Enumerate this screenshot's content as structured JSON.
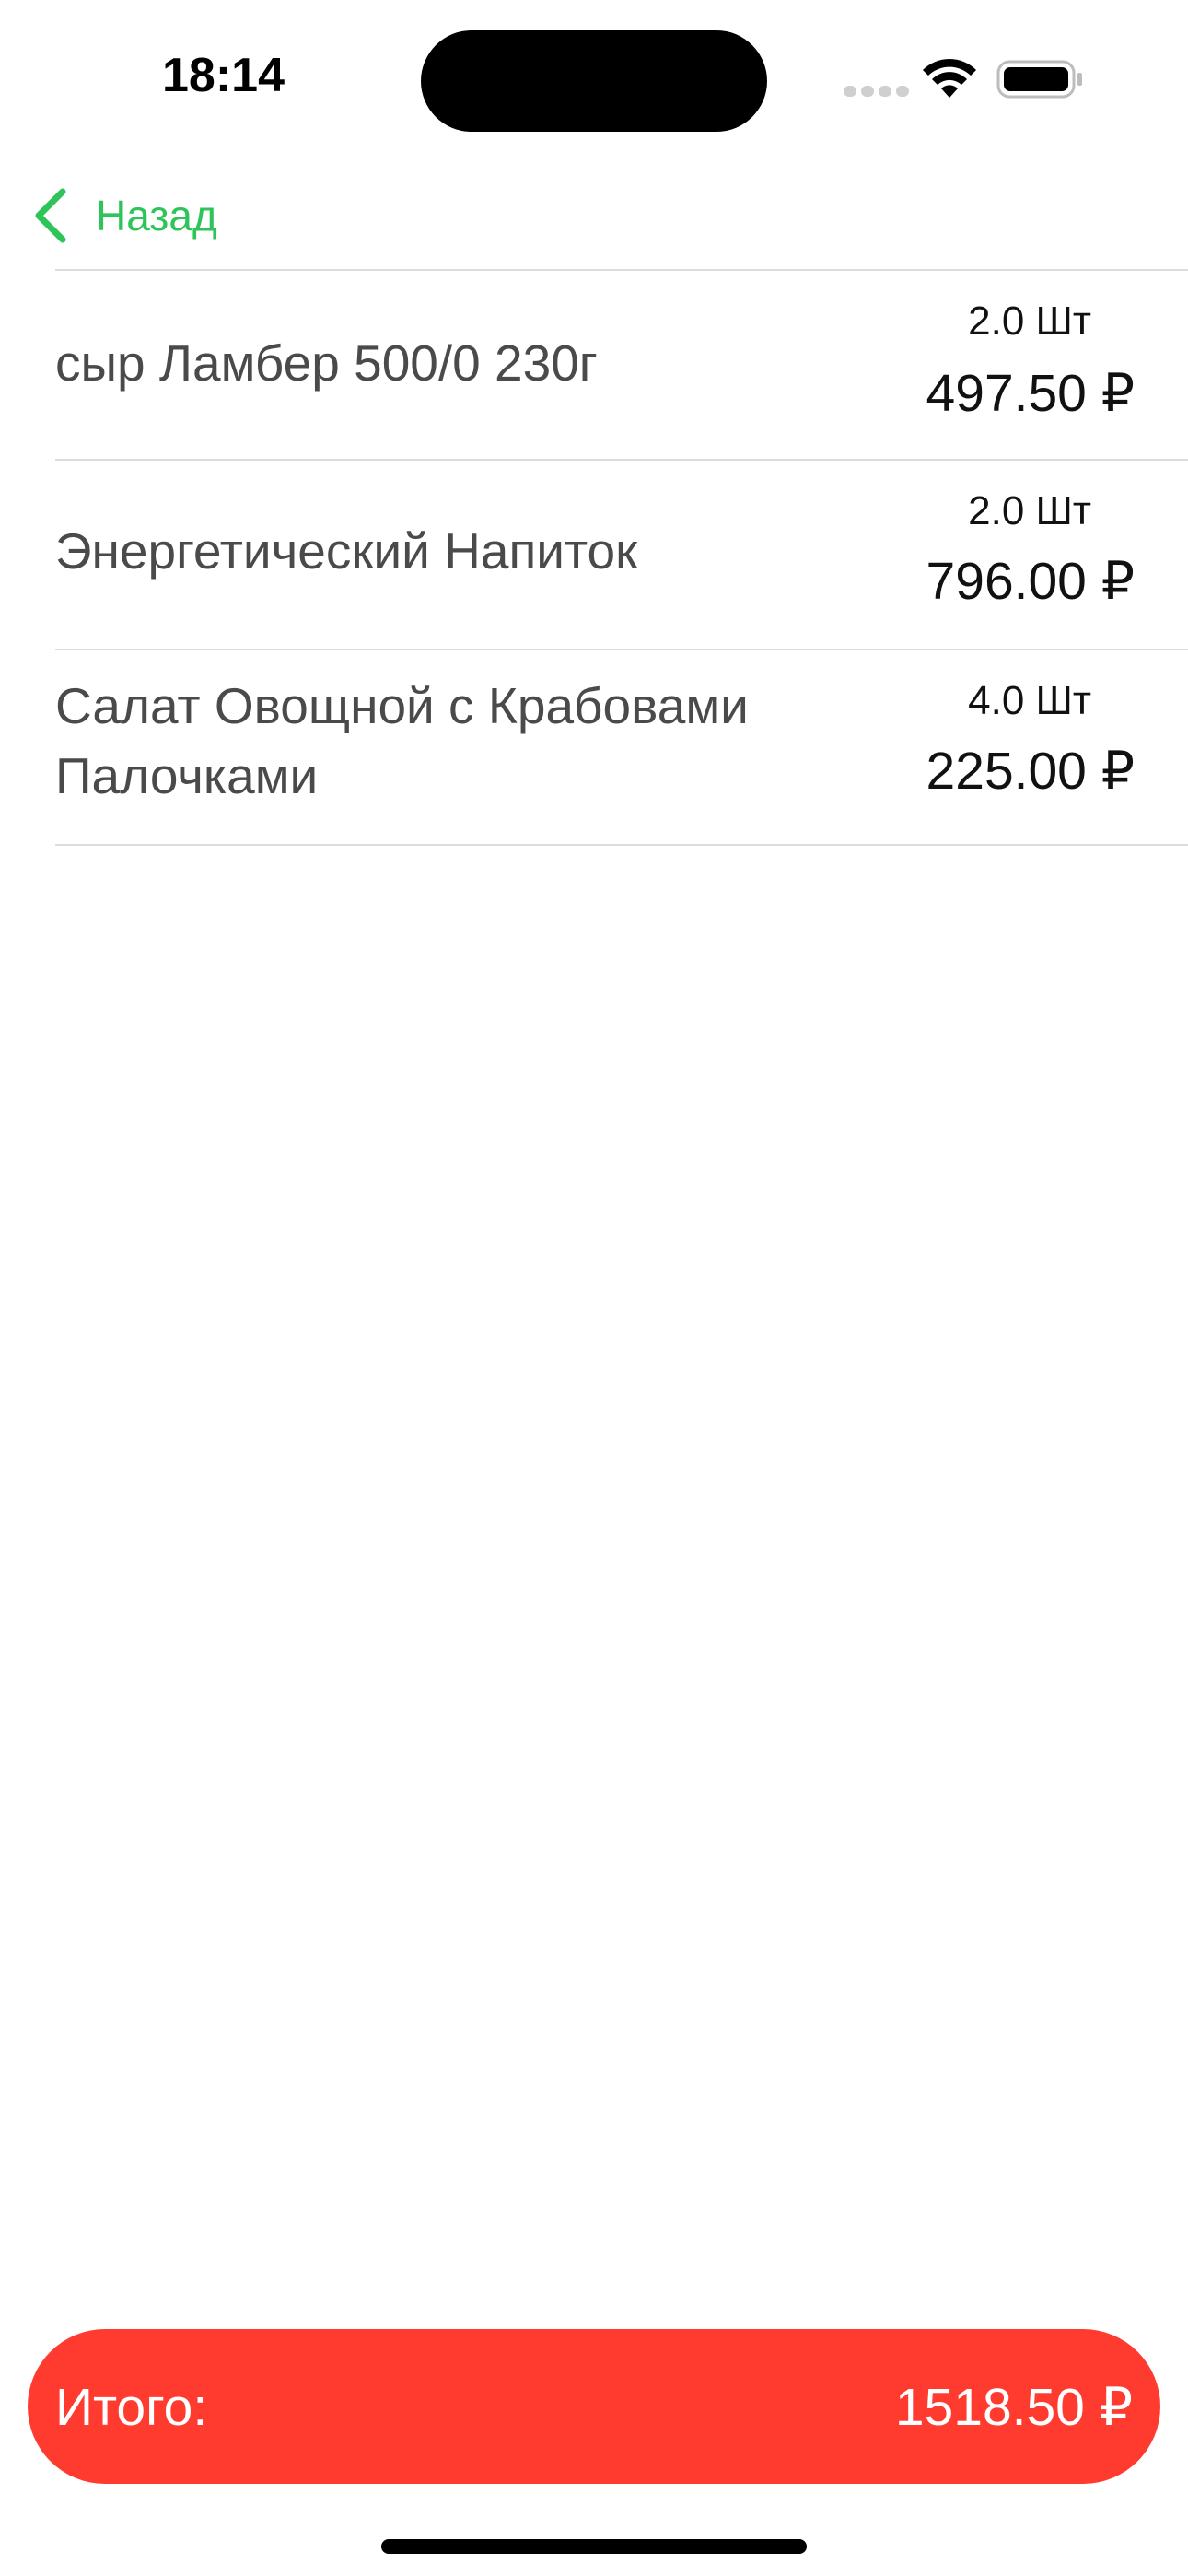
{
  "status_bar": {
    "time": "18:14",
    "icons": [
      "cellular-signal-icon",
      "wifi-icon",
      "battery-icon"
    ]
  },
  "nav": {
    "back_label": "Назад",
    "back_icon": "chevron-left-icon",
    "accent_color": "#2fc45a"
  },
  "items": [
    {
      "name": "сыр Ламбер 500/0 230г",
      "qty": "2.0 Шт",
      "price": "497.50 ₽"
    },
    {
      "name": "Энергетический Напиток",
      "qty": "2.0 Шт",
      "price": "796.00 ₽"
    },
    {
      "name": "Салат Овощной с Крабовами Палочками",
      "qty": "4.0 Шт",
      "price": "225.00 ₽"
    }
  ],
  "total": {
    "label": "Итого:",
    "value": "1518.50 ₽",
    "color": "#ff3b30"
  }
}
